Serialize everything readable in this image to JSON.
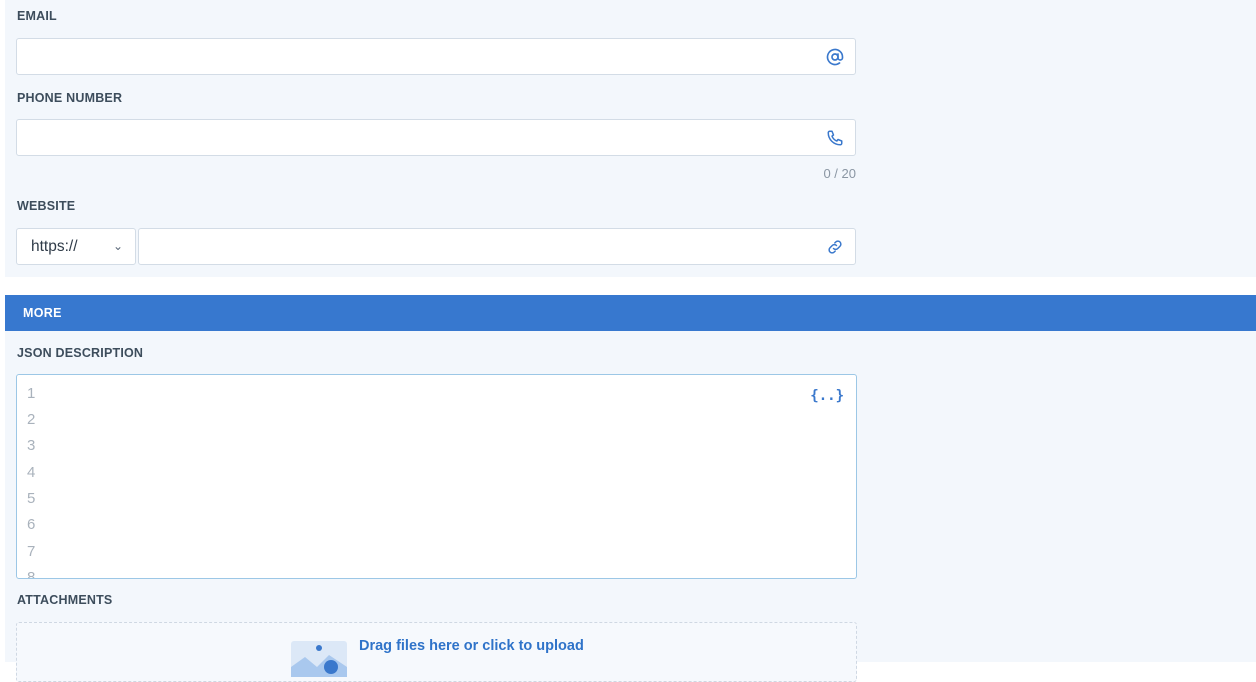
{
  "contact": {
    "email_label": "EMAIL",
    "email_value": "",
    "phone_label": "PHONE NUMBER",
    "phone_value": "",
    "phone_counter": "0 / 20",
    "website_label": "WEBSITE",
    "protocol_selected": "https://",
    "website_value": ""
  },
  "section": {
    "title": "MORE"
  },
  "json_description": {
    "label": "JSON DESCRIPTION",
    "icon_text": "{..}",
    "line_numbers": [
      "1",
      "2",
      "3",
      "4",
      "5",
      "6",
      "7",
      "8"
    ]
  },
  "attachments": {
    "label": "ATTACHMENTS",
    "dropzone_text": "Drag files here or click to upload"
  },
  "icons": {
    "email": "at-icon",
    "phone": "phone-icon",
    "website": "link-icon",
    "select": "chevron-down-icon",
    "upload": "image-upload-icon"
  },
  "colors": {
    "accent": "#3778cf",
    "panel_bg": "#f3f7fc",
    "text": "#3d4d5c",
    "muted": "#8a96a3"
  }
}
